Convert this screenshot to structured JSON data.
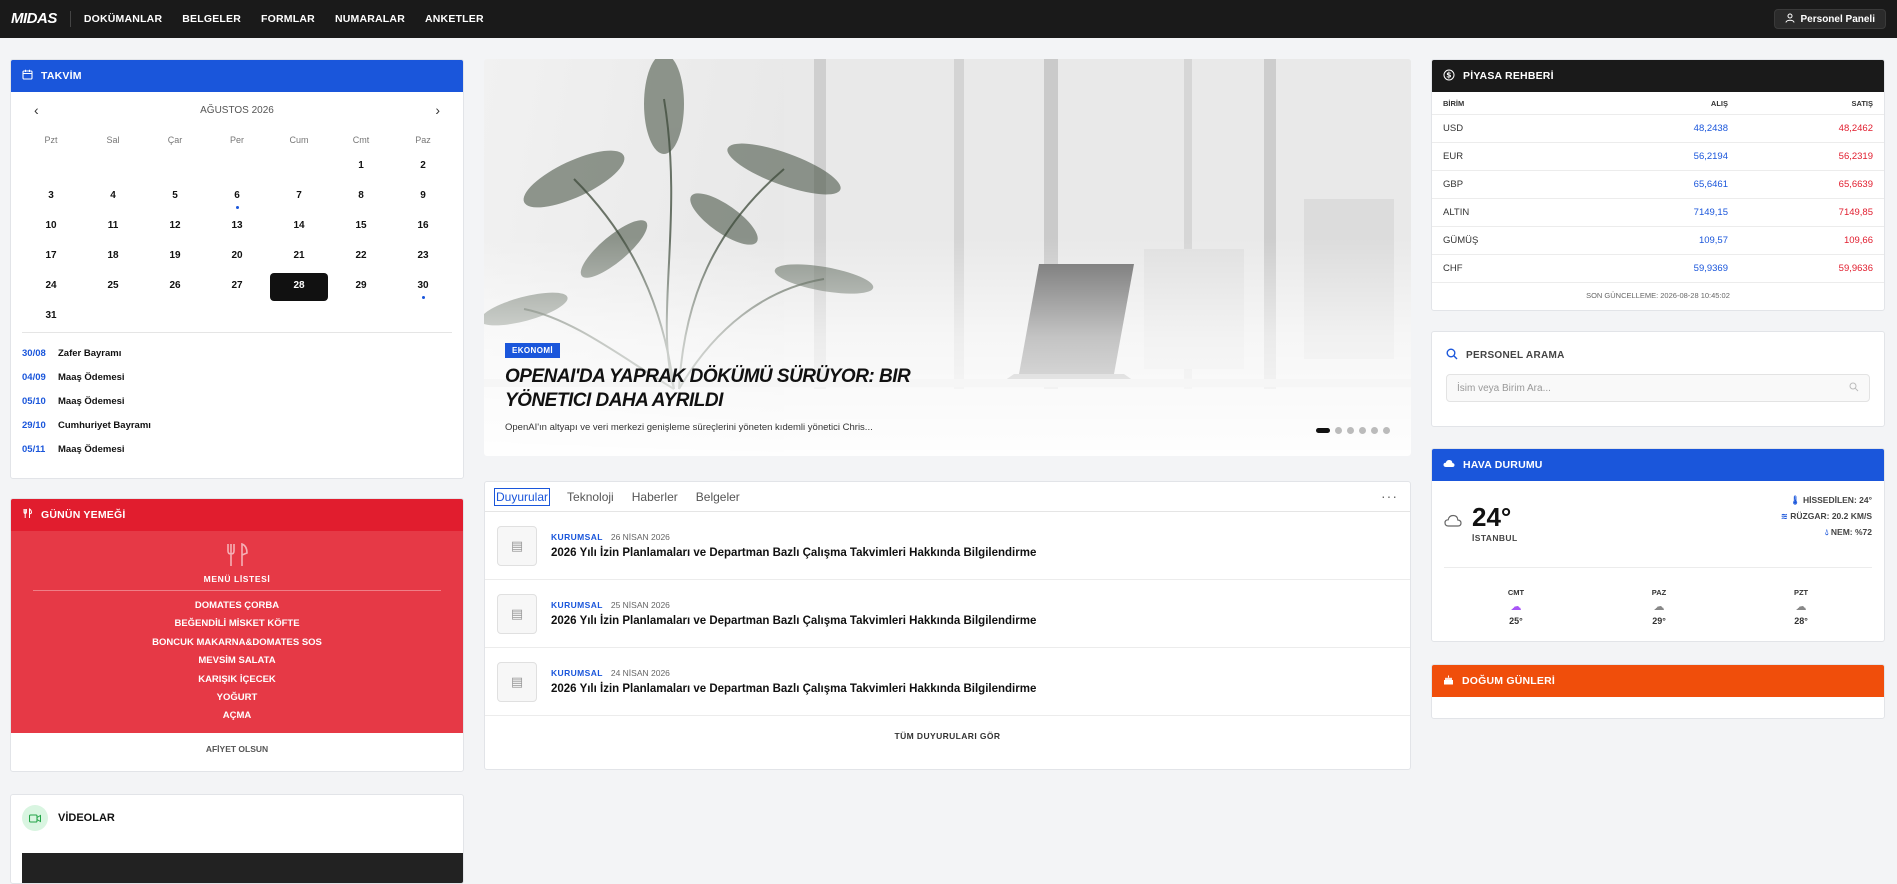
{
  "topbar": {
    "logo": "MIDAS",
    "nav": [
      "DOKÜMANLAR",
      "BELGELER",
      "FORMLAR",
      "NUMARALAR",
      "ANKETLER"
    ],
    "panel_button": "Personel Paneli"
  },
  "calendar": {
    "title": "TAKVİM",
    "month": "AĞUSTOS 2026",
    "prev": "‹",
    "next": "›",
    "weekdays": [
      "Pzt",
      "Sal",
      "Çar",
      "Per",
      "Cum",
      "Cmt",
      "Paz"
    ],
    "leading_blanks": 5,
    "days_in_month": 31,
    "selected_day": 28,
    "event_days": [
      6,
      30
    ],
    "events": [
      {
        "date": "30/08",
        "name": "Zafer Bayramı"
      },
      {
        "date": "04/09",
        "name": "Maaş Ödemesi"
      },
      {
        "date": "05/10",
        "name": "Maaş Ödemesi"
      },
      {
        "date": "29/10",
        "name": "Cumhuriyet Bayramı"
      },
      {
        "date": "05/11",
        "name": "Maaş Ödemesi"
      }
    ]
  },
  "menu": {
    "title": "GÜNÜN YEMEĞİ",
    "list_title": "MENÜ LİSTESİ",
    "items": [
      "DOMATES ÇORBA",
      "BEĞENDİLİ MİSKET KÖFTE",
      "BONCUK MAKARNA&DOMATES SOS",
      "MEVSİM SALATA",
      "KARIŞIK İÇECEK",
      "YOĞURT",
      "AÇMA"
    ],
    "footer": "AFİYET OLSUN"
  },
  "videos": {
    "title": "VİDEOLAR"
  },
  "hero": {
    "badge": "EKONOMİ",
    "title": "OPENAI'DA YAPRAK DÖKÜMÜ SÜRÜYOR: BIR YÖNETICI DAHA AYRILDI",
    "description": "OpenAI'ın altyapı ve veri merkezi genişleme süreçlerini yöneten kıdemli yönetici Chris...",
    "slide_count": 6,
    "active_slide": 0
  },
  "announcements": {
    "tabs": [
      "Duyurular",
      "Teknoloji",
      "Haberler",
      "Belgeler"
    ],
    "active_tab": 0,
    "more": "···",
    "items": [
      {
        "category": "KURUMSAL",
        "date": "26 NİSAN 2026",
        "title": "2026 Yılı İzin Planlamaları ve Departman Bazlı Çalışma Takvimleri Hakkında Bilgilendirme"
      },
      {
        "category": "KURUMSAL",
        "date": "25 NİSAN 2026",
        "title": "2026 Yılı İzin Planlamaları ve Departman Bazlı Çalışma Takvimleri Hakkında Bilgilendirme"
      },
      {
        "category": "KURUMSAL",
        "date": "24 NİSAN 2026",
        "title": "2026 Yılı İzin Planlamaları ve Departman Bazlı Çalışma Takvimleri Hakkında Bilgilendirme"
      }
    ],
    "footer": "TÜM DUYURULARI GÖR"
  },
  "market": {
    "title": "PİYASA REHBERİ",
    "headers": [
      "BİRİM",
      "ALIŞ",
      "SATIŞ"
    ],
    "rows": [
      [
        "USD",
        "48,2438",
        "48,2462"
      ],
      [
        "EUR",
        "56,2194",
        "56,2319"
      ],
      [
        "GBP",
        "65,6461",
        "65,6639"
      ],
      [
        "ALTIN",
        "7149,15",
        "7149,85"
      ],
      [
        "GÜMÜŞ",
        "109,57",
        "109,66"
      ],
      [
        "CHF",
        "59,9369",
        "59,9636"
      ]
    ],
    "updated": "SON GÜNCELLEME: 2026-08-28 10:45:02"
  },
  "search": {
    "title": "PERSONEL ARAMA",
    "placeholder": "İsim veya Birim Ara..."
  },
  "weather": {
    "title": "HAVA DURUMU",
    "temp": "24°",
    "city": "İSTANBUL",
    "feels": "HİSSEDİLEN: 24°",
    "wind": "RÜZGAR: 20.2 KM/S",
    "humidity": "NEM: %72",
    "forecast": [
      {
        "day": "CMT",
        "temp": "25°"
      },
      {
        "day": "PAZ",
        "temp": "29°"
      },
      {
        "day": "PZT",
        "temp": "28°"
      }
    ]
  },
  "birthdays": {
    "title": "DOĞUM GÜNLERİ"
  },
  "colors": {
    "blue": "#1a56db",
    "red": "#e11d2e",
    "orange": "#f04e0b",
    "dark": "#1a1a1a"
  }
}
